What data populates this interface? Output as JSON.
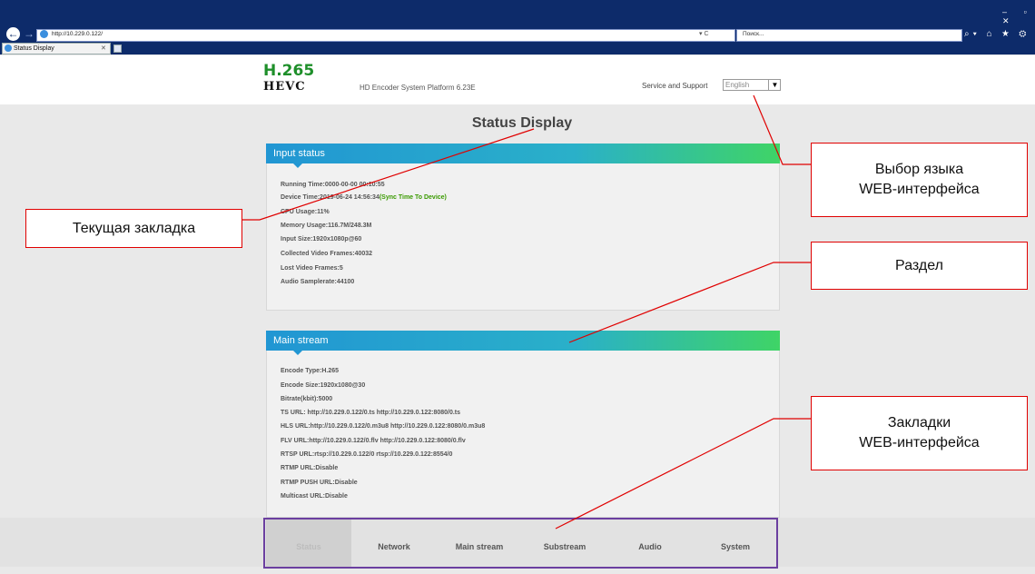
{
  "browser": {
    "address": "http://10.229.0.122/",
    "address_controls": "▾ C",
    "search_placeholder": "Поиск...",
    "tab_label": "Status Display",
    "toolbar_icons": "⌕▾ ⌂ ★ ⚙",
    "window_controls": "– ▫ ✕"
  },
  "header": {
    "logo_line1": "H.265",
    "logo_line2": "HEVC",
    "platform": "HD Encoder System Platform 6.23E",
    "service": "Service and Support",
    "language": "English"
  },
  "page_title": "Status Display",
  "input_status": {
    "title": "Input status",
    "running_time": "Running Time:0000-00-00 00:10:55",
    "device_time": "Device Time:2019-06-24 14:56:34",
    "sync_link": "(Sync Time To Device)",
    "cpu": "CPU Usage:11%",
    "memory": "Memory Usage:116.7M/248.3M",
    "input_size": "Input Size:1920x1080p@60",
    "collected": "Collected Video Frames:40032",
    "lost": "Lost Video Frames:5",
    "audio": "Audio Samplerate:44100"
  },
  "main_stream": {
    "title": "Main stream",
    "encode_type": "Encode Type:H.265",
    "encode_size": "Encode Size:1920x1080@30",
    "bitrate": "Bitrate(kbit):5000",
    "ts_url": "TS URL:  http://10.229.0.122/0.ts  http://10.229.0.122:8080/0.ts",
    "hls_url": "HLS URL:http://10.229.0.122/0.m3u8  http://10.229.0.122:8080/0.m3u8",
    "flv_url": "FLV URL:http://10.229.0.122/0.flv  http://10.229.0.122:8080/0.flv",
    "rtsp_url": "RTSP URL:rtsp://10.229.0.122/0  rtsp://10.229.0.122:8554/0",
    "rtmp_url": "RTMP URL:Disable",
    "rtmp_push": "RTMP PUSH URL:Disable",
    "multicast": "Multicast URL:Disable"
  },
  "nav": [
    "Status",
    "Network",
    "Main stream",
    "Substream",
    "Audio",
    "System"
  ],
  "annotations": {
    "lang_line1": "Выбор языка",
    "lang_line2": "WEB-интерфейса",
    "current_tab": "Текущая закладка",
    "section": "Раздел",
    "tabs_line1": "Закладки",
    "tabs_line2": "WEB-интерфейса"
  },
  "colors": {
    "accent_red": "#e00000",
    "nav_frame": "#6b3fa0",
    "logo_green": "#1e8f2a"
  }
}
